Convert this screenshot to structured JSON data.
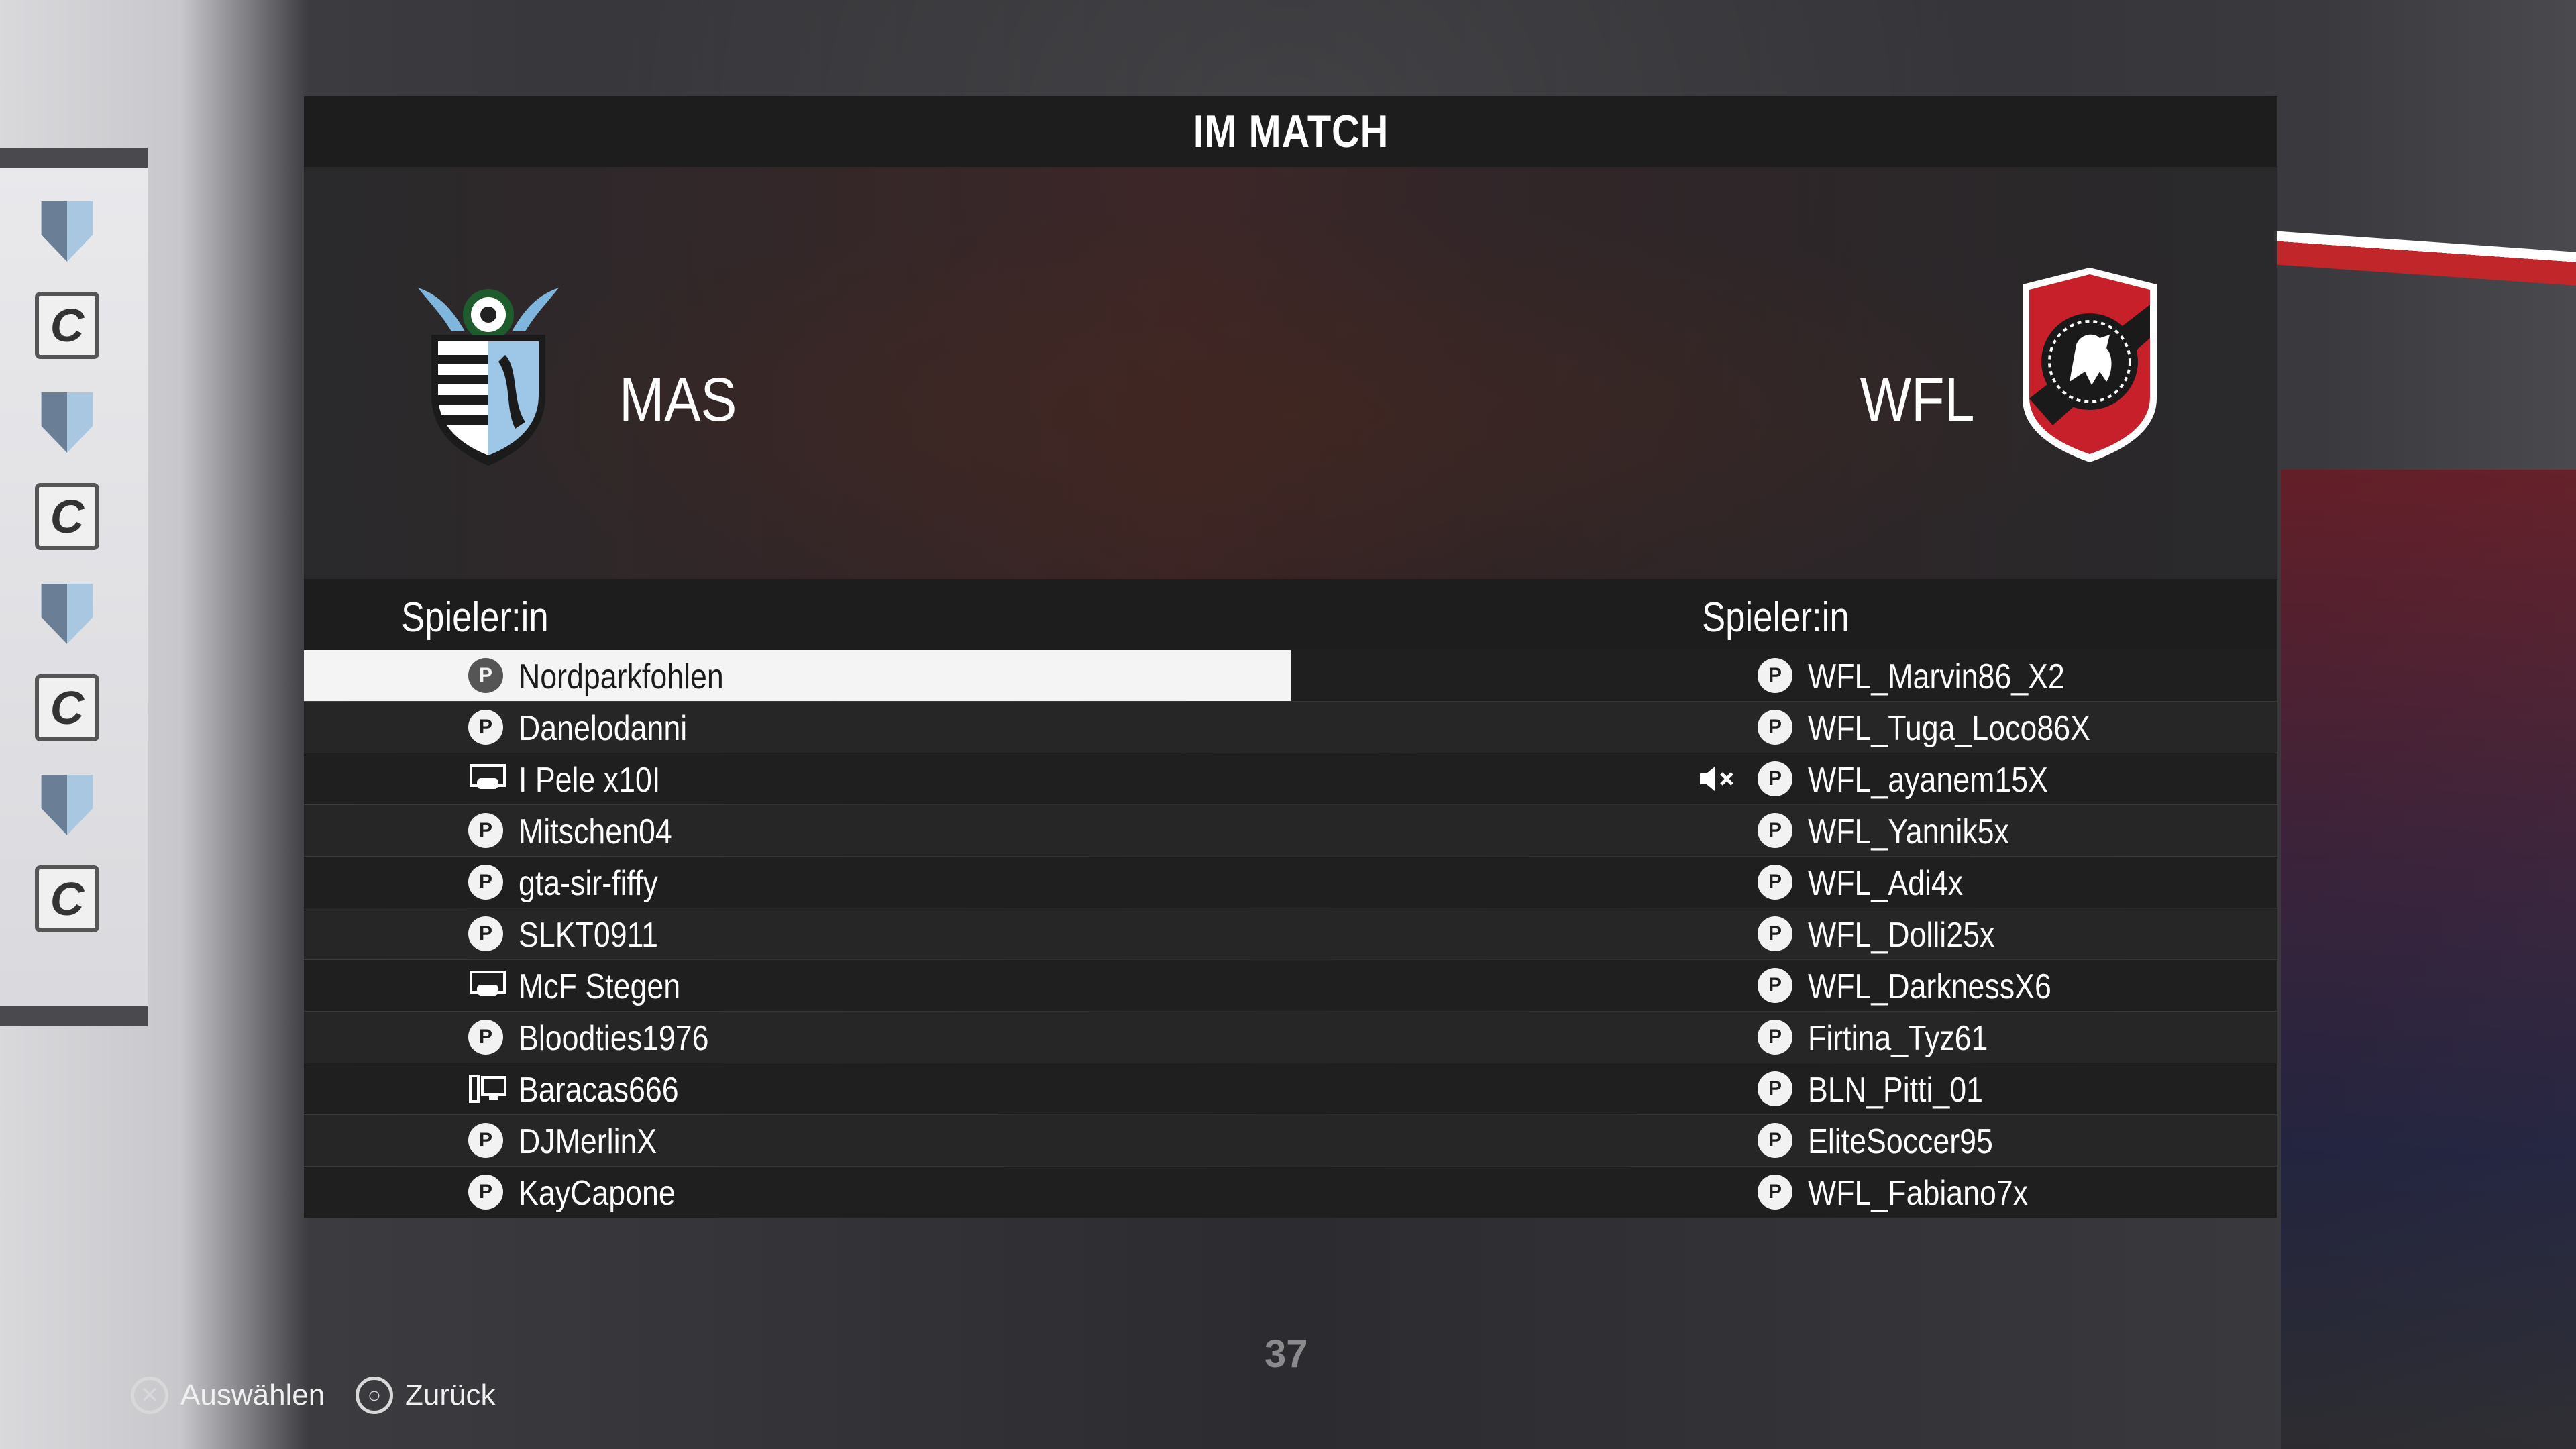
{
  "header": {
    "title": "IM MATCH"
  },
  "teams": {
    "home": {
      "abbr": "MAS",
      "crest_icon": "mas-winged-shield-crest"
    },
    "away": {
      "abbr": "WFL",
      "crest_icon": "wfl-lion-shield-crest"
    }
  },
  "columns": {
    "left_header": "Spieler:in",
    "right_header": "Spieler:in"
  },
  "home_players": [
    {
      "name": "Nordparkfohlen",
      "platform": "playstation-icon",
      "selected": true
    },
    {
      "name": "Danelodanni",
      "platform": "playstation-icon"
    },
    {
      "name": "I Pele x10I",
      "platform": "pc-icon"
    },
    {
      "name": "Mitschen04",
      "platform": "playstation-icon"
    },
    {
      "name": "gta-sir-fiffy",
      "platform": "playstation-icon"
    },
    {
      "name": "SLKT0911",
      "platform": "playstation-icon"
    },
    {
      "name": "McF Stegen",
      "platform": "pc-icon"
    },
    {
      "name": "Bloodties1976",
      "platform": "playstation-icon"
    },
    {
      "name": "Baracas666",
      "platform": "xbox-series-icon"
    },
    {
      "name": "DJMerlinX",
      "platform": "playstation-icon"
    },
    {
      "name": "KayCapone",
      "platform": "playstation-icon"
    }
  ],
  "away_players": [
    {
      "name": "WFL_Marvin86_X2",
      "platform": "playstation-icon"
    },
    {
      "name": "WFL_Tuga_Loco86X",
      "platform": "playstation-icon"
    },
    {
      "name": "WFL_ayanem15X",
      "platform": "playstation-icon",
      "muted": true
    },
    {
      "name": "WFL_Yannik5x",
      "platform": "playstation-icon"
    },
    {
      "name": "WFL_Adi4x",
      "platform": "playstation-icon"
    },
    {
      "name": "WFL_Dolli25x",
      "platform": "playstation-icon"
    },
    {
      "name": "WFL_DarknessX6",
      "platform": "playstation-icon"
    },
    {
      "name": "Firtina_Tyz61",
      "platform": "playstation-icon"
    },
    {
      "name": "BLN_Pitti_01",
      "platform": "playstation-icon"
    },
    {
      "name": "EliteSoccer95",
      "platform": "playstation-icon"
    },
    {
      "name": "WFL_Fabiano7x",
      "platform": "playstation-icon"
    }
  ],
  "timer": "37",
  "footer": {
    "select_label": "Auswählen",
    "back_label": "Zurück"
  },
  "colors": {
    "panel_bg": "#1d1d1e",
    "row_odd": "#1f1f20",
    "row_even": "#262627",
    "selected_row": "#f4f4f4",
    "wfl_red": "#c8202a",
    "mas_blue": "#9ec6e6"
  }
}
